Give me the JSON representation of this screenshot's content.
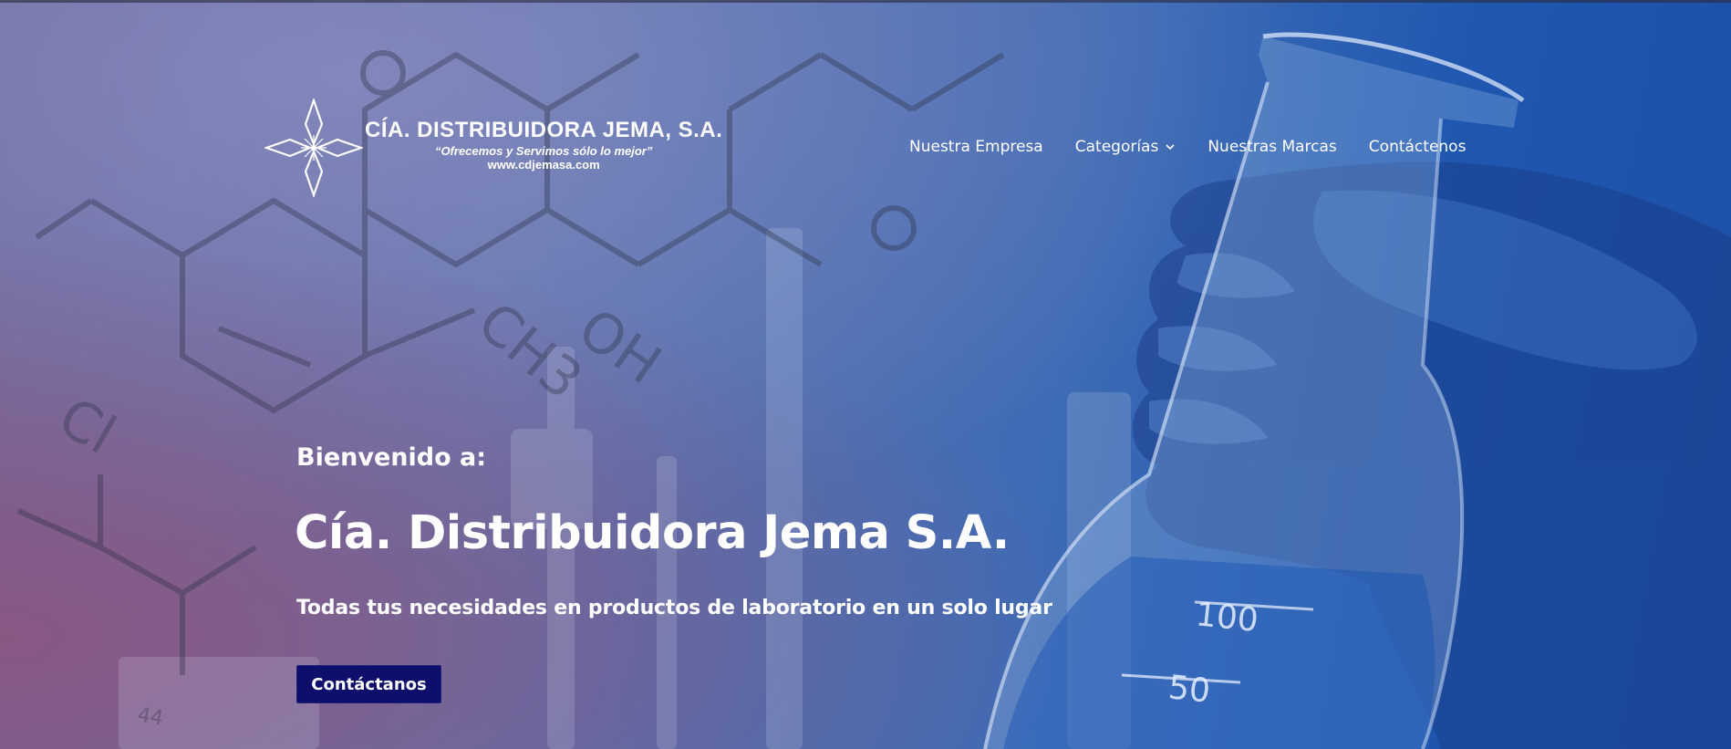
{
  "header": {
    "logo": {
      "name": "CÍA. DISTRIBUIDORA JEMA, S.A.",
      "slogan": "“Ofrecemos y Servimos sólo lo mejor”",
      "url": "www.cdjemasa.com",
      "mark_icon": "four-point-star-icon"
    },
    "nav": {
      "items": [
        {
          "label": "Nuestra Empresa"
        },
        {
          "label": "Categorías",
          "icon": "chevron-down-icon"
        },
        {
          "label": "Nuestras Marcas"
        },
        {
          "label": "Contáctenos"
        }
      ]
    }
  },
  "hero": {
    "welcome": "Bienvenido a:",
    "headline": "Cía. Distribuidora Jema S.A.",
    "subline": "Todas tus necesidades en productos de laboratorio en un solo lugar",
    "cta_label": "Contáctanos",
    "background_labels": {
      "cl": "Cl",
      "ch3": "CH3",
      "oh": "OH",
      "mark_100": "100",
      "mark_50": "50",
      "mark_44": "44"
    }
  },
  "colors": {
    "cta_background": "#0d0f6b",
    "text": "#ffffff",
    "overlay_left": "#6b6a9e",
    "overlay_right": "#1d4fa7"
  }
}
